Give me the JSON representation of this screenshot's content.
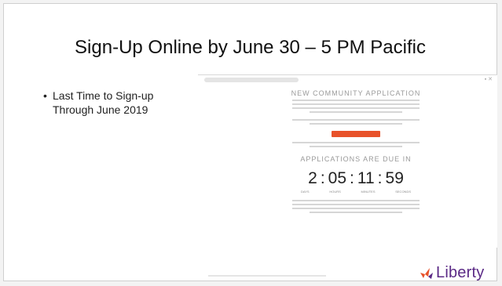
{
  "slide": {
    "title": "Sign-Up Online by June 30 – 5 PM Pacific",
    "bullet": "•",
    "bullet_text_line1": "Last Time to Sign-up",
    "bullet_text_line2": "Through June 2019",
    "embedded_screenshot": {
      "app_title": "NEW COMMUNITY APPLICATION",
      "due_title": "APPLICATIONS ARE DUE IN",
      "countdown": {
        "days": "2",
        "hours": "05",
        "minutes": "11",
        "seconds": "59"
      },
      "units": [
        "DAYS",
        "HOURS",
        "MINUTES",
        "SECONDS"
      ]
    },
    "logo_text": "Liberty",
    "colors": {
      "logo": "#5b2a86",
      "accent": "#e8522a"
    }
  }
}
